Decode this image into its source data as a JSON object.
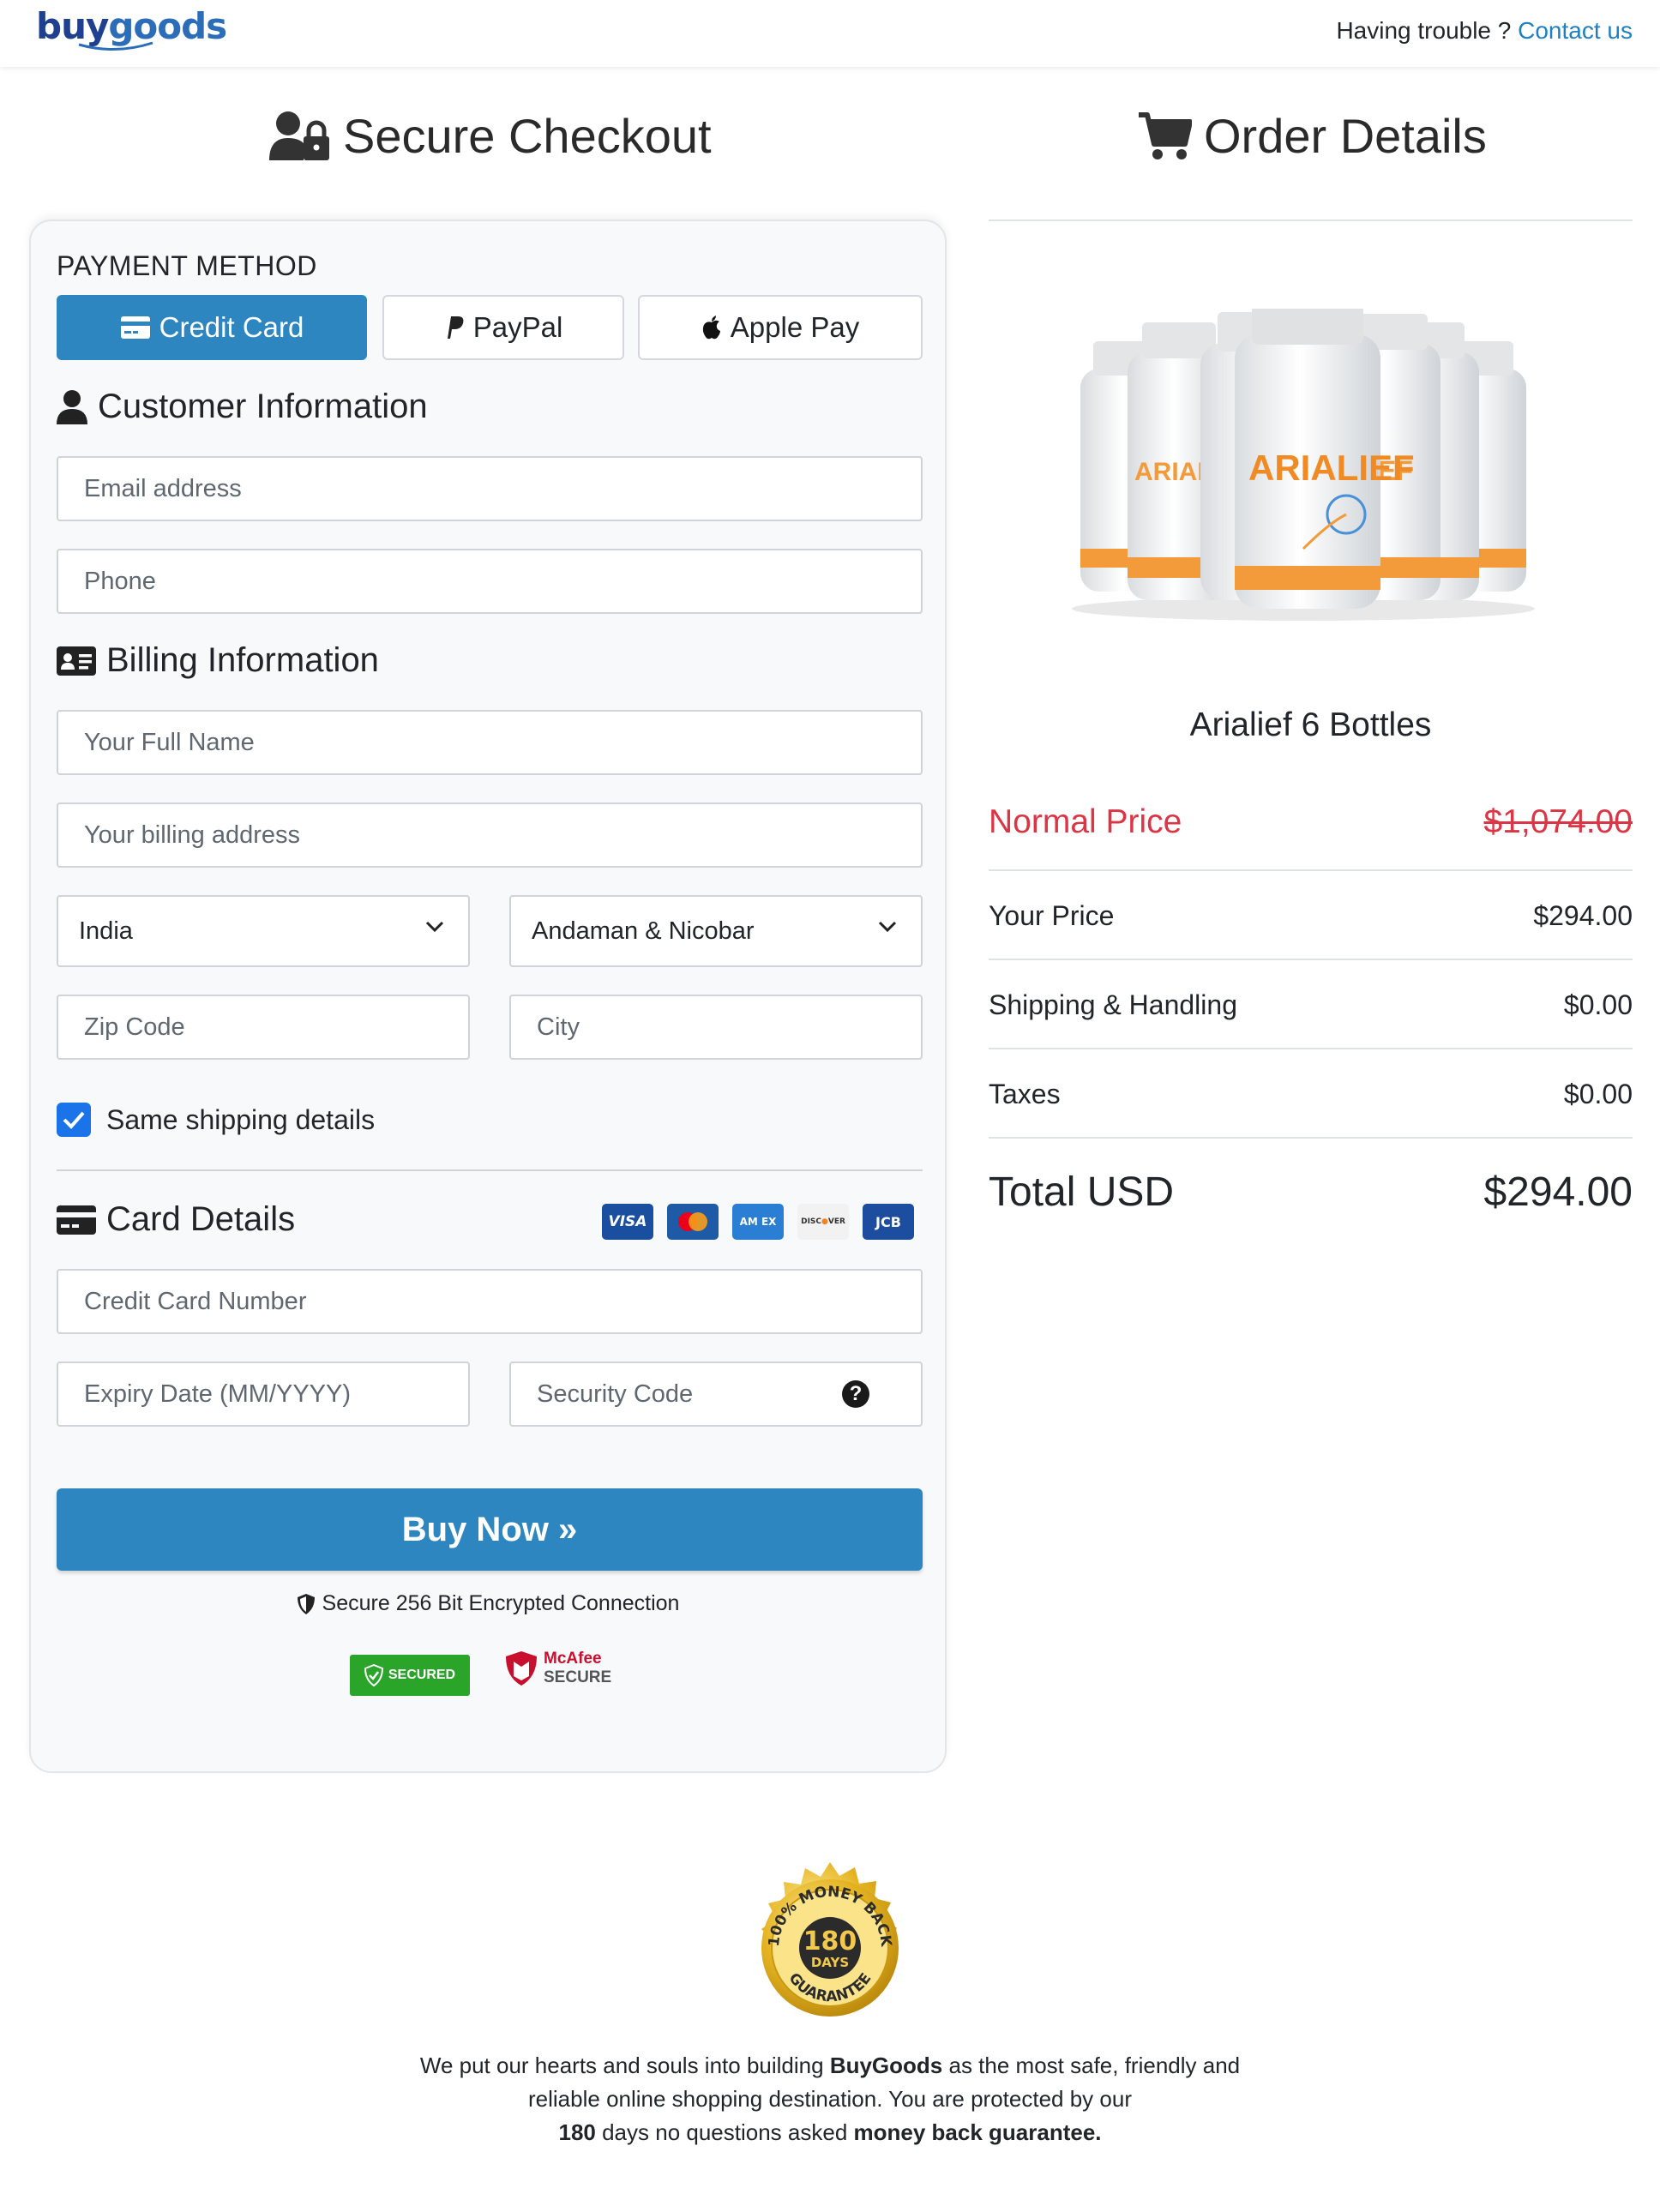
{
  "header": {
    "logo": {
      "part1": "buy",
      "part2": "goods"
    },
    "trouble_text": "Having trouble ?",
    "contact_link": "Contact us"
  },
  "checkout": {
    "title": "Secure Checkout",
    "payment_method_label": "PAYMENT METHOD",
    "payment_methods": {
      "credit_card": "Credit Card",
      "paypal": "PayPal",
      "apple_pay": "Apple Pay"
    },
    "customer_info": {
      "title": "Customer Information",
      "email_placeholder": "Email address",
      "phone_placeholder": "Phone"
    },
    "billing": {
      "title": "Billing Information",
      "full_name_placeholder": "Your Full Name",
      "address_placeholder": "Your billing address",
      "country": "India",
      "state": "Andaman & Nicobar",
      "zip_placeholder": "Zip Code",
      "city_placeholder": "City",
      "same_shipping_label": "Same shipping details",
      "same_shipping_checked": true
    },
    "card_details": {
      "title": "Card Details",
      "brands": [
        "VISA",
        "MASTERCARD",
        "AMEX",
        "DISCOVER",
        "JCB"
      ],
      "card_number_placeholder": "Credit Card Number",
      "expiry_placeholder": "Expiry Date (MM/YYYY)",
      "cvv_placeholder": "Security Code"
    },
    "buy_button": "Buy Now »",
    "secure_text": "Secure 256 Bit Encrypted Connection",
    "badges": {
      "trust_guard": "SECURED",
      "mcafee_1": "McAfee",
      "mcafee_2": "SECURE"
    }
  },
  "order": {
    "title": "Order Details",
    "product_label": "ARIALIEF",
    "product_name": "Arialief 6 Bottles",
    "normal_price_label": "Normal Price",
    "normal_price": "$1,074.00",
    "your_price_label": "Your Price",
    "your_price": "$294.00",
    "shipping_label": "Shipping & Handling",
    "shipping": "$0.00",
    "taxes_label": "Taxes",
    "taxes": "$0.00",
    "total_label": "Total USD",
    "total": "$294.00"
  },
  "guarantee": {
    "seal": {
      "top": "100% MONEY BACK",
      "days_num": "180",
      "days": "DAYS",
      "bottom": "GUARANTEE"
    },
    "p1": "We put our hearts and souls into building ",
    "brand": "BuyGoods",
    "p2": " as the most safe, friendly and reliable online shopping destination. You are protected by our ",
    "days": "180",
    "p3": " days no questions asked ",
    "mbg": "money back guarantee."
  },
  "colors": {
    "primary": "#2e86c1",
    "danger": "#dc3545",
    "link": "#1f7fbf",
    "checkbox": "#1a73e8"
  }
}
